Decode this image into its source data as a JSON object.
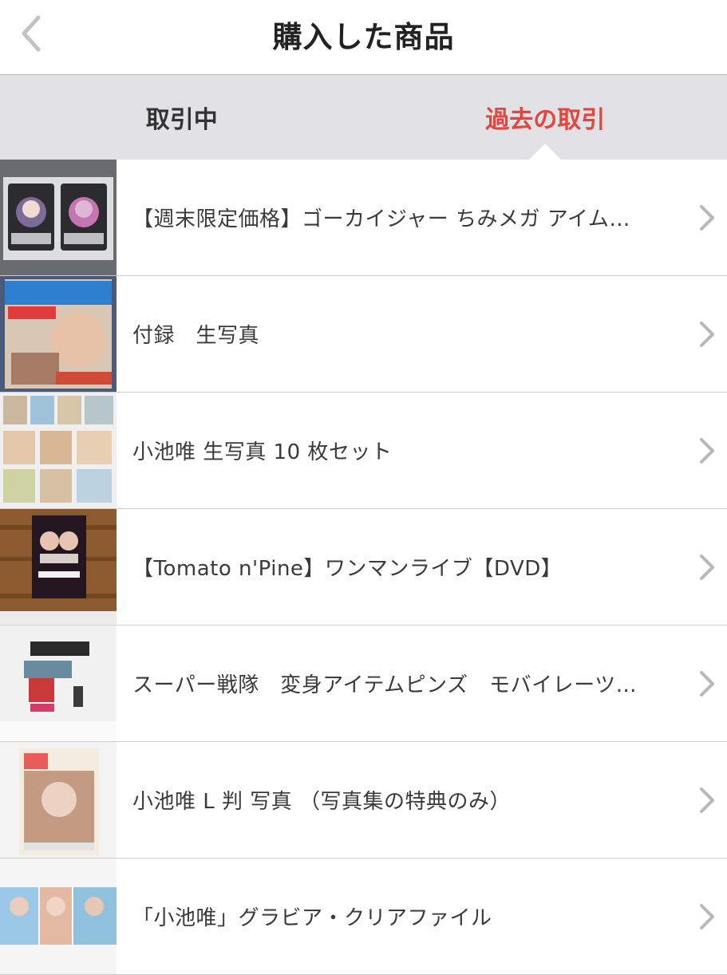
{
  "header": {
    "title": "購入した商品"
  },
  "tabs": [
    {
      "label": "取引中",
      "active": false
    },
    {
      "label": "過去の取引",
      "active": true
    }
  ],
  "colors": {
    "accent": "#e4453d",
    "tab_bg": "#e2e2e6",
    "chevron": "#b8b8bc"
  },
  "icons": {
    "back": "chevron-left-icon",
    "row": "chevron-right-icon"
  },
  "items": [
    {
      "title": "【週末限定価格】ゴーカイジャー ちみメガ アイム…"
    },
    {
      "title": "付録　生写真"
    },
    {
      "title": "小池唯 生写真 10 枚セット"
    },
    {
      "title": "【Tomato n'Pine】ワンマンライブ【DVD】"
    },
    {
      "title": "スーパー戦隊　変身アイテムピンズ　モバイレーツ…"
    },
    {
      "title": "小池唯 L 判 写真 （写真集の特典のみ）"
    },
    {
      "title": "「小池唯」グラビア・クリアファイル"
    }
  ]
}
